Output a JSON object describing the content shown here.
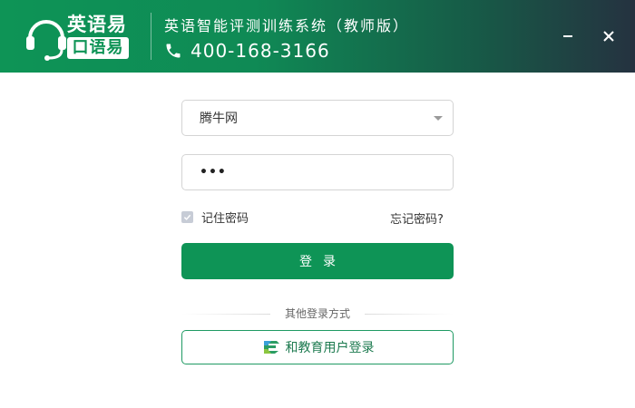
{
  "header": {
    "logo_line1": "英语易",
    "logo_line2": "口语易",
    "app_title": "英语智能评测训练系统（教师版）",
    "phone": "400-168-3166",
    "minimize_icon": "minimize-icon",
    "close_icon": "close-icon"
  },
  "form": {
    "school_value": "腾牛网",
    "password_dots": "•••",
    "remember_label": "记住密码",
    "remember_checked": true,
    "forgot_label": "忘记密码?",
    "login_label": "登录"
  },
  "other_login": {
    "divider_label": "其他登录方式",
    "alt_login_label": "和教育用户登录"
  },
  "colors": {
    "brand_green": "#0e9456",
    "header_dark": "#253240"
  }
}
